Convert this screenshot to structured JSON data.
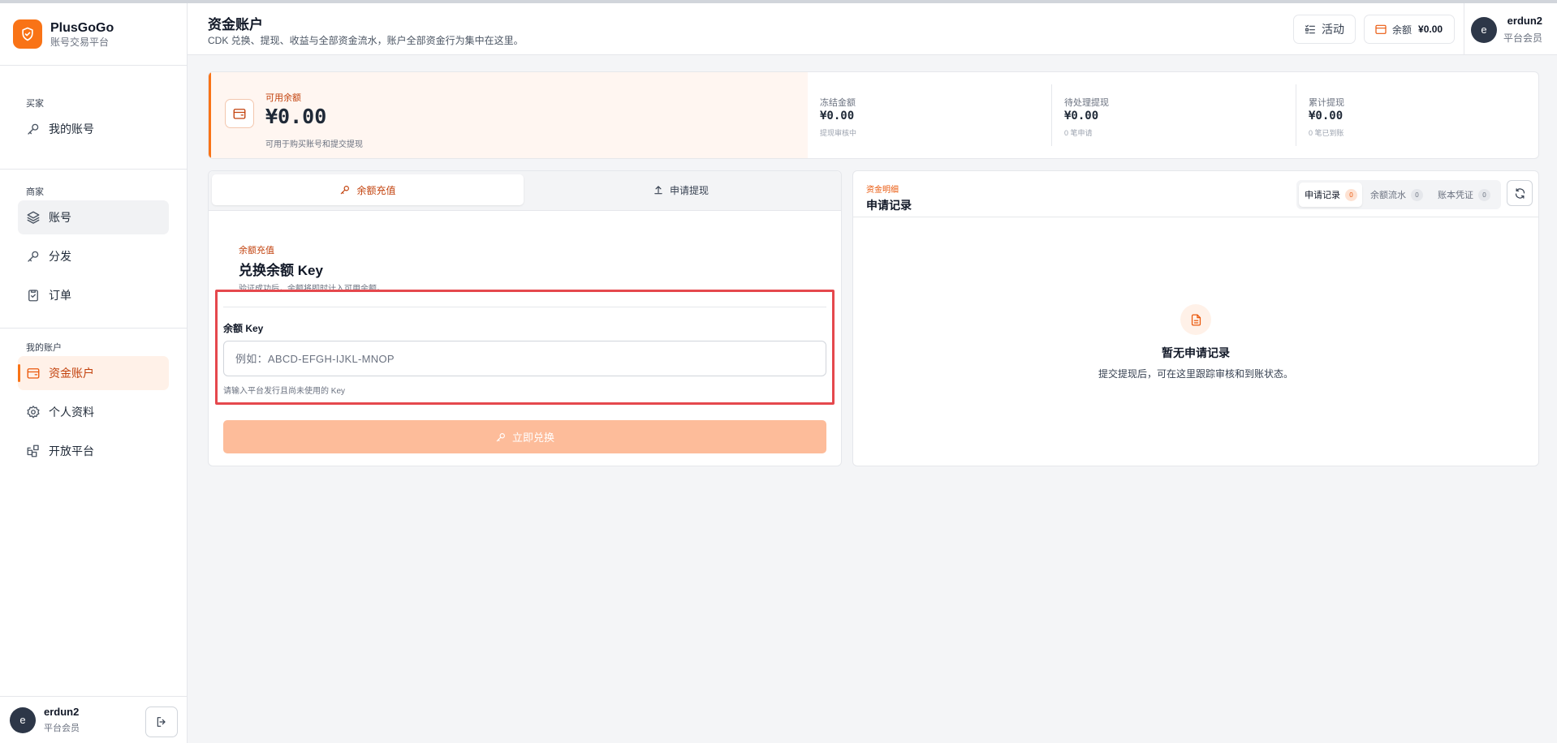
{
  "brand": {
    "name": "PlusGoGo",
    "subtitle": "账号交易平台"
  },
  "sidebar": {
    "sections": [
      {
        "label": "买家",
        "items": [
          {
            "label": "我的账号",
            "icon": "key-icon"
          }
        ]
      },
      {
        "label": "商家",
        "items": [
          {
            "label": "账号",
            "icon": "layers-icon"
          },
          {
            "label": "分发",
            "icon": "key-icon"
          },
          {
            "label": "订单",
            "icon": "clipboard-icon"
          }
        ]
      },
      {
        "label": "我的账户",
        "items": [
          {
            "label": "资金账户",
            "icon": "wallet-icon"
          },
          {
            "label": "个人资料",
            "icon": "gear-icon"
          },
          {
            "label": "开放平台",
            "icon": "apps-icon"
          }
        ]
      }
    ],
    "user": {
      "avatar": "e",
      "name": "erdun2",
      "role": "平台会员"
    }
  },
  "header": {
    "title": "资金账户",
    "subtitle": "CDK 兑换、提现、收益与全部资金流水，账户全部资金行为集中在这里。",
    "activity_label": "活动",
    "balance_label": "余额",
    "balance_value": "¥0.00",
    "user": {
      "avatar": "e",
      "name": "erdun2",
      "role": "平台会员"
    }
  },
  "balance": {
    "label": "可用余额",
    "amount": "¥0.00",
    "note": "可用于购买账号和提交提现",
    "stats": [
      {
        "label": "冻结金额",
        "value": "¥0.00",
        "note": "提现审核中"
      },
      {
        "label": "待处理提现",
        "value": "¥0.00",
        "note": "0 笔申请"
      },
      {
        "label": "累计提现",
        "value": "¥0.00",
        "note": "0 笔已到账"
      }
    ]
  },
  "redeem": {
    "tabs": [
      {
        "label": "余额充值",
        "icon": "key-icon"
      },
      {
        "label": "申请提现",
        "icon": "upload-icon"
      }
    ],
    "kicker": "余额充值",
    "title": "兑换余额 Key",
    "description": "验证成功后，余额将即时计入可用余额。",
    "field_label": "余额 Key",
    "placeholder": "例如：ABCD-EFGH-IJKL-MNOP",
    "value": "",
    "help": "请输入平台发行且尚未使用的 Key",
    "submit_label": "立即兑换"
  },
  "records": {
    "kicker": "资金明细",
    "title": "申请记录",
    "tabs": [
      {
        "label": "申请记录",
        "count": "0"
      },
      {
        "label": "余额流水",
        "count": "0"
      },
      {
        "label": "账本凭证",
        "count": "0"
      }
    ],
    "empty_title": "暂无申请记录",
    "empty_desc": "提交提现后，可在这里跟踪审核和到账状态。"
  },
  "colors": {
    "accent": "#f97316",
    "accent_dark": "#c2410c",
    "highlight": "#e5484d"
  }
}
